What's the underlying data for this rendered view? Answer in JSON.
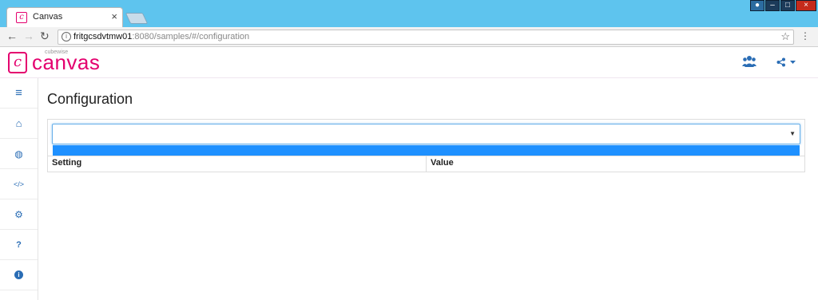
{
  "browser": {
    "tab_title": "Canvas",
    "tab_close": "×",
    "url_host": "fritgcsdvtmw01",
    "url_rest": ":8080/samples/#/configuration"
  },
  "app": {
    "logo_super": "cubewise",
    "logo_text": "canvas"
  },
  "sidebar": {
    "items": [
      {
        "icon": "menu-icon",
        "glyph": "≡"
      },
      {
        "icon": "home-icon",
        "glyph": "⌂"
      },
      {
        "icon": "globe-icon",
        "glyph": "◍"
      },
      {
        "icon": "code-icon",
        "glyph": "</>"
      },
      {
        "icon": "cogs-icon",
        "glyph": "⚙"
      },
      {
        "icon": "help-icon",
        "glyph": "?"
      },
      {
        "icon": "info-icon",
        "glyph": "i"
      }
    ]
  },
  "main": {
    "title": "Configuration",
    "select_value": "",
    "columns": [
      "Setting",
      "Value"
    ]
  },
  "colors": {
    "brand": "#e4006e",
    "accent": "#2a6db5",
    "selection": "#1e90ff",
    "titlebar": "#5ec4ee"
  }
}
